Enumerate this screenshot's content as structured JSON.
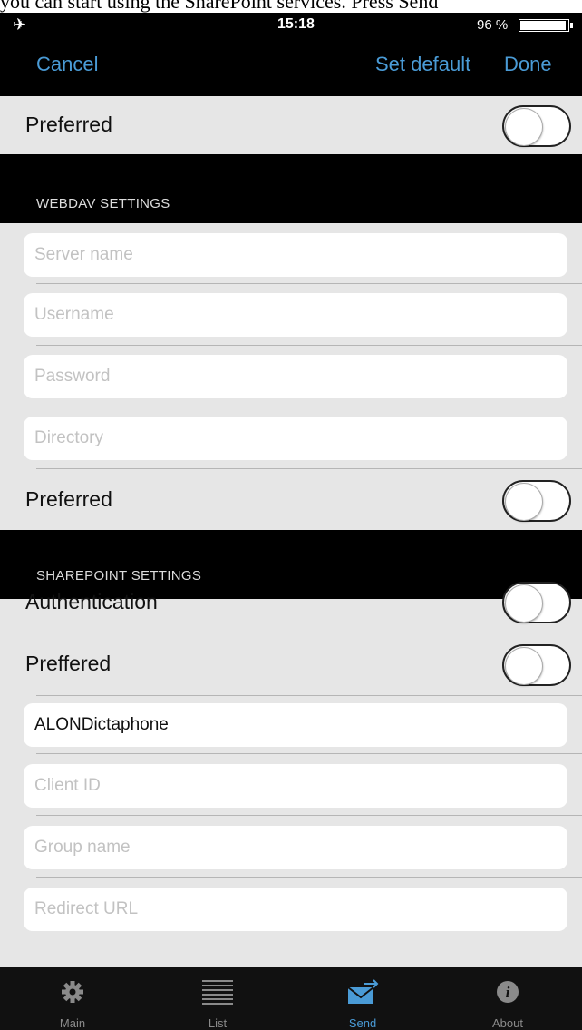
{
  "caption": "you can start using the SharePoint services. Press Send",
  "status": {
    "time": "15:18",
    "battery": "96 %"
  },
  "nav": {
    "cancel": "Cancel",
    "set_default": "Set default",
    "done": "Done"
  },
  "rows": {
    "preferred_top": "Preferred",
    "webdav_header": "WEBDAV SETTINGS",
    "webdav_preferred": "Preferred",
    "sharepoint_header": "SHAREPOINT SETTINGS",
    "authentication": "Authentication",
    "preffered": "Preffered"
  },
  "webdav": {
    "server_name": {
      "placeholder": "Server name",
      "value": ""
    },
    "username": {
      "placeholder": "Username",
      "value": ""
    },
    "password": {
      "placeholder": "Password",
      "value": ""
    },
    "directory": {
      "placeholder": "Directory",
      "value": ""
    }
  },
  "sharepoint": {
    "site": {
      "placeholder": "",
      "value": "ALONDictaphone"
    },
    "client_id": {
      "placeholder": "Client ID",
      "value": ""
    },
    "group_name": {
      "placeholder": "Group name",
      "value": ""
    },
    "redirect_url": {
      "placeholder": "Redirect URL",
      "value": ""
    }
  },
  "toggles": {
    "preferred_top": false,
    "webdav_preferred": false,
    "authentication": false,
    "preffered": false
  },
  "tabs": [
    {
      "label": "Main",
      "icon": "gear-icon"
    },
    {
      "label": "List",
      "icon": "list-icon"
    },
    {
      "label": "Send",
      "icon": "send-icon"
    },
    {
      "label": "About",
      "icon": "info-icon"
    }
  ],
  "active_tab": "Send",
  "colors": {
    "accent": "#4a9bd6",
    "background": "#e6e6e6",
    "bar": "#000000"
  }
}
